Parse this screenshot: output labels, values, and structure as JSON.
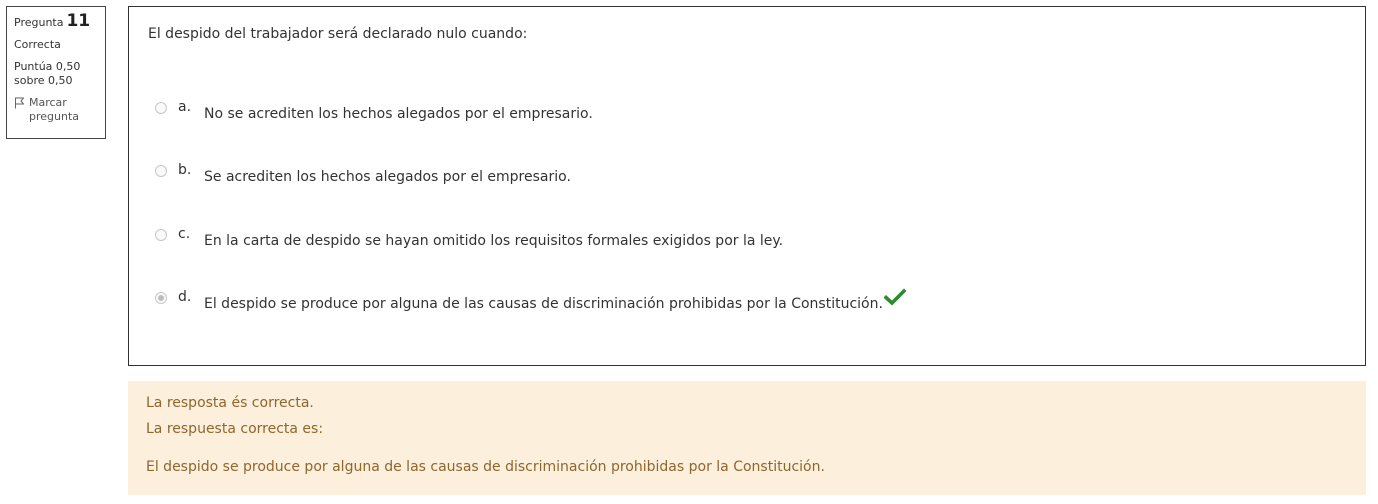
{
  "info": {
    "question_label": "Pregunta",
    "question_number": "11",
    "state": "Correcta",
    "grade_line1": "Puntúa 0,50",
    "grade_line2": "sobre 0,50",
    "flag_line1": "Marcar",
    "flag_line2": "pregunta",
    "flag_icon": "flag-icon"
  },
  "question": {
    "text": "El despido del trabajador será declarado nulo cuando:",
    "options": [
      {
        "letter": "a.",
        "text": "No se acrediten los hechos alegados por el empresario.",
        "selected": false
      },
      {
        "letter": "b.",
        "text": "Se acrediten los hechos alegados por el empresario.",
        "selected": false
      },
      {
        "letter": "c.",
        "text": "En la carta de despido se hayan omitido los requisitos formales exigidos por la ley.",
        "selected": false
      },
      {
        "letter": "d.",
        "text": "El despido se produce por alguna de las causas de discriminación prohibidas por la Constitución.",
        "selected": true,
        "correct_icon": "checkmark-icon"
      }
    ]
  },
  "feedback": {
    "result": "La resposta és correcta.",
    "correct_label": "La respuesta correcta es:",
    "correct_answer": "El despido se produce por alguna de las causas de discriminación prohibidas por la Constitución."
  },
  "colors": {
    "feedback_bg": "#fcefdc",
    "feedback_text": "#8e662e",
    "check_green": "#2e8b2e"
  }
}
